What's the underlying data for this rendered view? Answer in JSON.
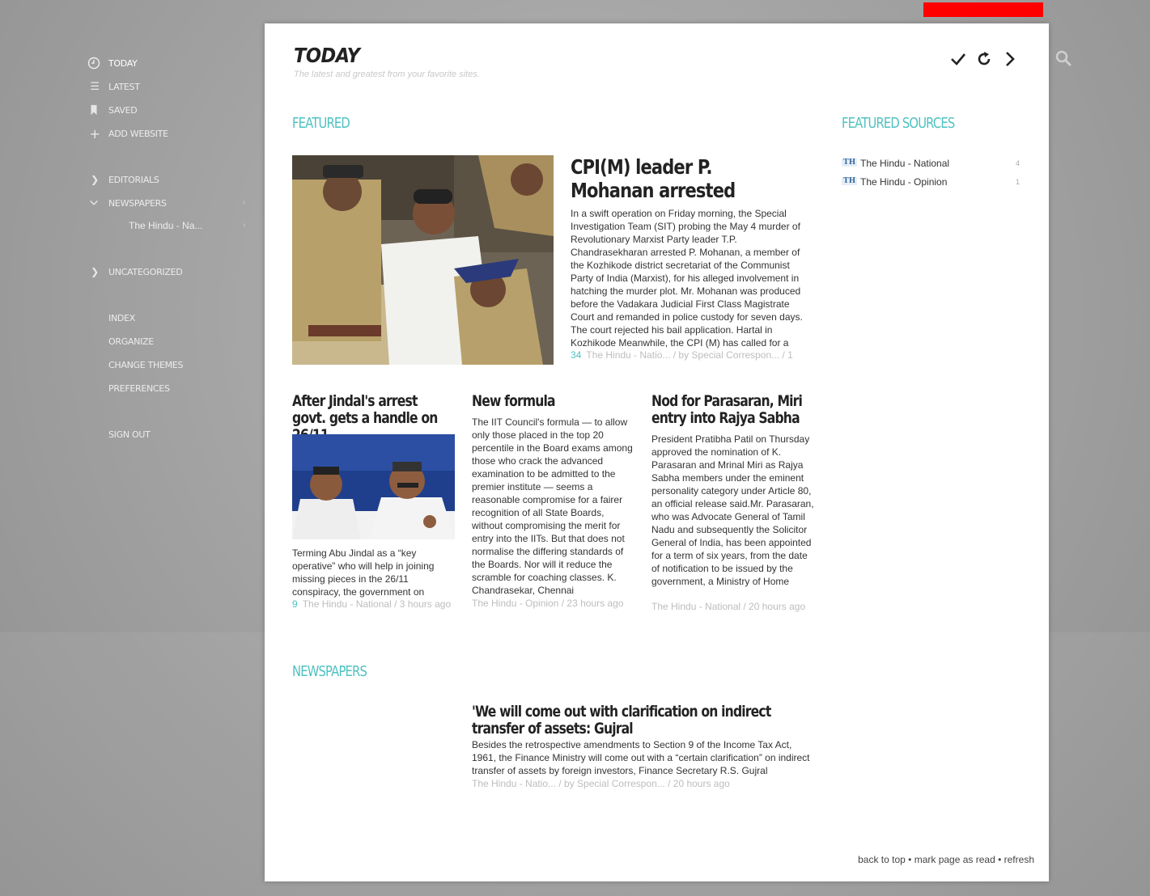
{
  "sidebar": {
    "items": [
      {
        "label": "TODAY",
        "icon": "clock-icon"
      },
      {
        "label": "LATEST",
        "icon": "list-icon"
      },
      {
        "label": "SAVED",
        "icon": "bookmark-icon"
      },
      {
        "label": "ADD WEBSITE",
        "icon": "plus-icon"
      },
      {
        "label": "EDITORIALS",
        "icon": "chevron-right-icon"
      },
      {
        "label": "NEWSPAPERS",
        "icon": "chevron-down-icon"
      },
      {
        "label": "UNCATEGORIZED",
        "icon": "chevron-right-icon"
      },
      {
        "label": "INDEX"
      },
      {
        "label": "ORGANIZE"
      },
      {
        "label": "CHANGE THEMES"
      },
      {
        "label": "PREFERENCES"
      },
      {
        "label": "SIGN OUT"
      }
    ],
    "sub_item": "The Hindu - Na..."
  },
  "header": {
    "title": "TODAY",
    "subtitle": "The latest and greatest from your favorite sites."
  },
  "sections": {
    "featured": "FEATURED",
    "featured_sources": "FEATURED SOURCES",
    "newspapers": "NEWSPAPERS"
  },
  "featured_main": {
    "headline": "CPI(M) leader P. Mohanan arrested",
    "body": "In a swift operation on Friday morning, the Special Investigation Team (SIT) probing the May 4 murder of Revolutionary Marxist Party leader T.P. Chandrasekharan arrested P. Mohanan, a member of the Kozhikode district secretariat of the Communist Party of India (Marxist), for his alleged involvement in hatching the murder plot. Mr. Mohanan was produced before the Vadakara Judicial First Class Magistrate Court and remanded in police custody for seven days. The court rejected his bail application. Hartal in Kozhikode Meanwhile, the CPI (M) has called for a",
    "count": "34",
    "meta": "The Hindu - Natio... / by Special Correspon... / 1"
  },
  "articles": [
    {
      "headline": "After Jindal's arrest govt. gets a handle on 26/11",
      "body": "Terming Abu Jindal as a “key operative” who will help in joining missing pieces in the 26/11 conspiracy, the government on",
      "count": "9",
      "meta": "The Hindu - National / 3 hours ago"
    },
    {
      "headline": "New formula",
      "body": "The IIT Council's formula — to allow only those placed in the top 20 percentile in the Board exams among those who crack the advanced examination to be admitted to the premier institute — seems a reasonable compromise for a fairer recognition of all State Boards, without compromising the merit for entry into the IITs. But that does not normalise the differing standards of the Boards. Nor will it reduce the scramble for coaching classes. K. Chandrasekar, Chennai",
      "meta": "The Hindu - Opinion / 23 hours ago"
    },
    {
      "headline": "Nod for Parasaran, Miri entry into Rajya Sabha",
      "body": "President Pratibha Patil on Thursday approved the nomination of K. Parasaran and Mrinal Miri as Rajya Sabha members under the eminent personality category under Article 80, an official release said.Mr. Parasaran, who was Advocate General of Tamil Nadu and subsequently the Solicitor General of India, has been appointed for a term of six years, from the date of notification to be issued by the government, a Ministry of Home",
      "meta": "The Hindu - National / 20 hours ago"
    }
  ],
  "newspaper_article": {
    "headline": "'We will come out with clarification on indirect transfer of assets: Gujral",
    "body": "Besides the retrospective amendments to Section 9 of the Income Tax Act, 1961, the Finance Ministry will come out with a “certain clarification” on indirect transfer of assets by foreign investors, Finance Secretary R.S. Gujral",
    "meta": "The Hindu - Natio... / by Special Correspon... / 20 hours ago"
  },
  "featured_sources": [
    {
      "badge": "TH",
      "name": "The Hindu - National",
      "count": "4"
    },
    {
      "badge": "TH",
      "name": "The Hindu - Opinion",
      "count": "1"
    }
  ],
  "footer": {
    "back_to_top": "back to top",
    "sep": " • ",
    "mark_read": "mark page as read",
    "refresh": "refresh"
  },
  "colors": {
    "accent": "#4fc1c1",
    "background": "#a6a6a6",
    "panel": "#ffffff",
    "alert_bar": "#ff0000"
  }
}
